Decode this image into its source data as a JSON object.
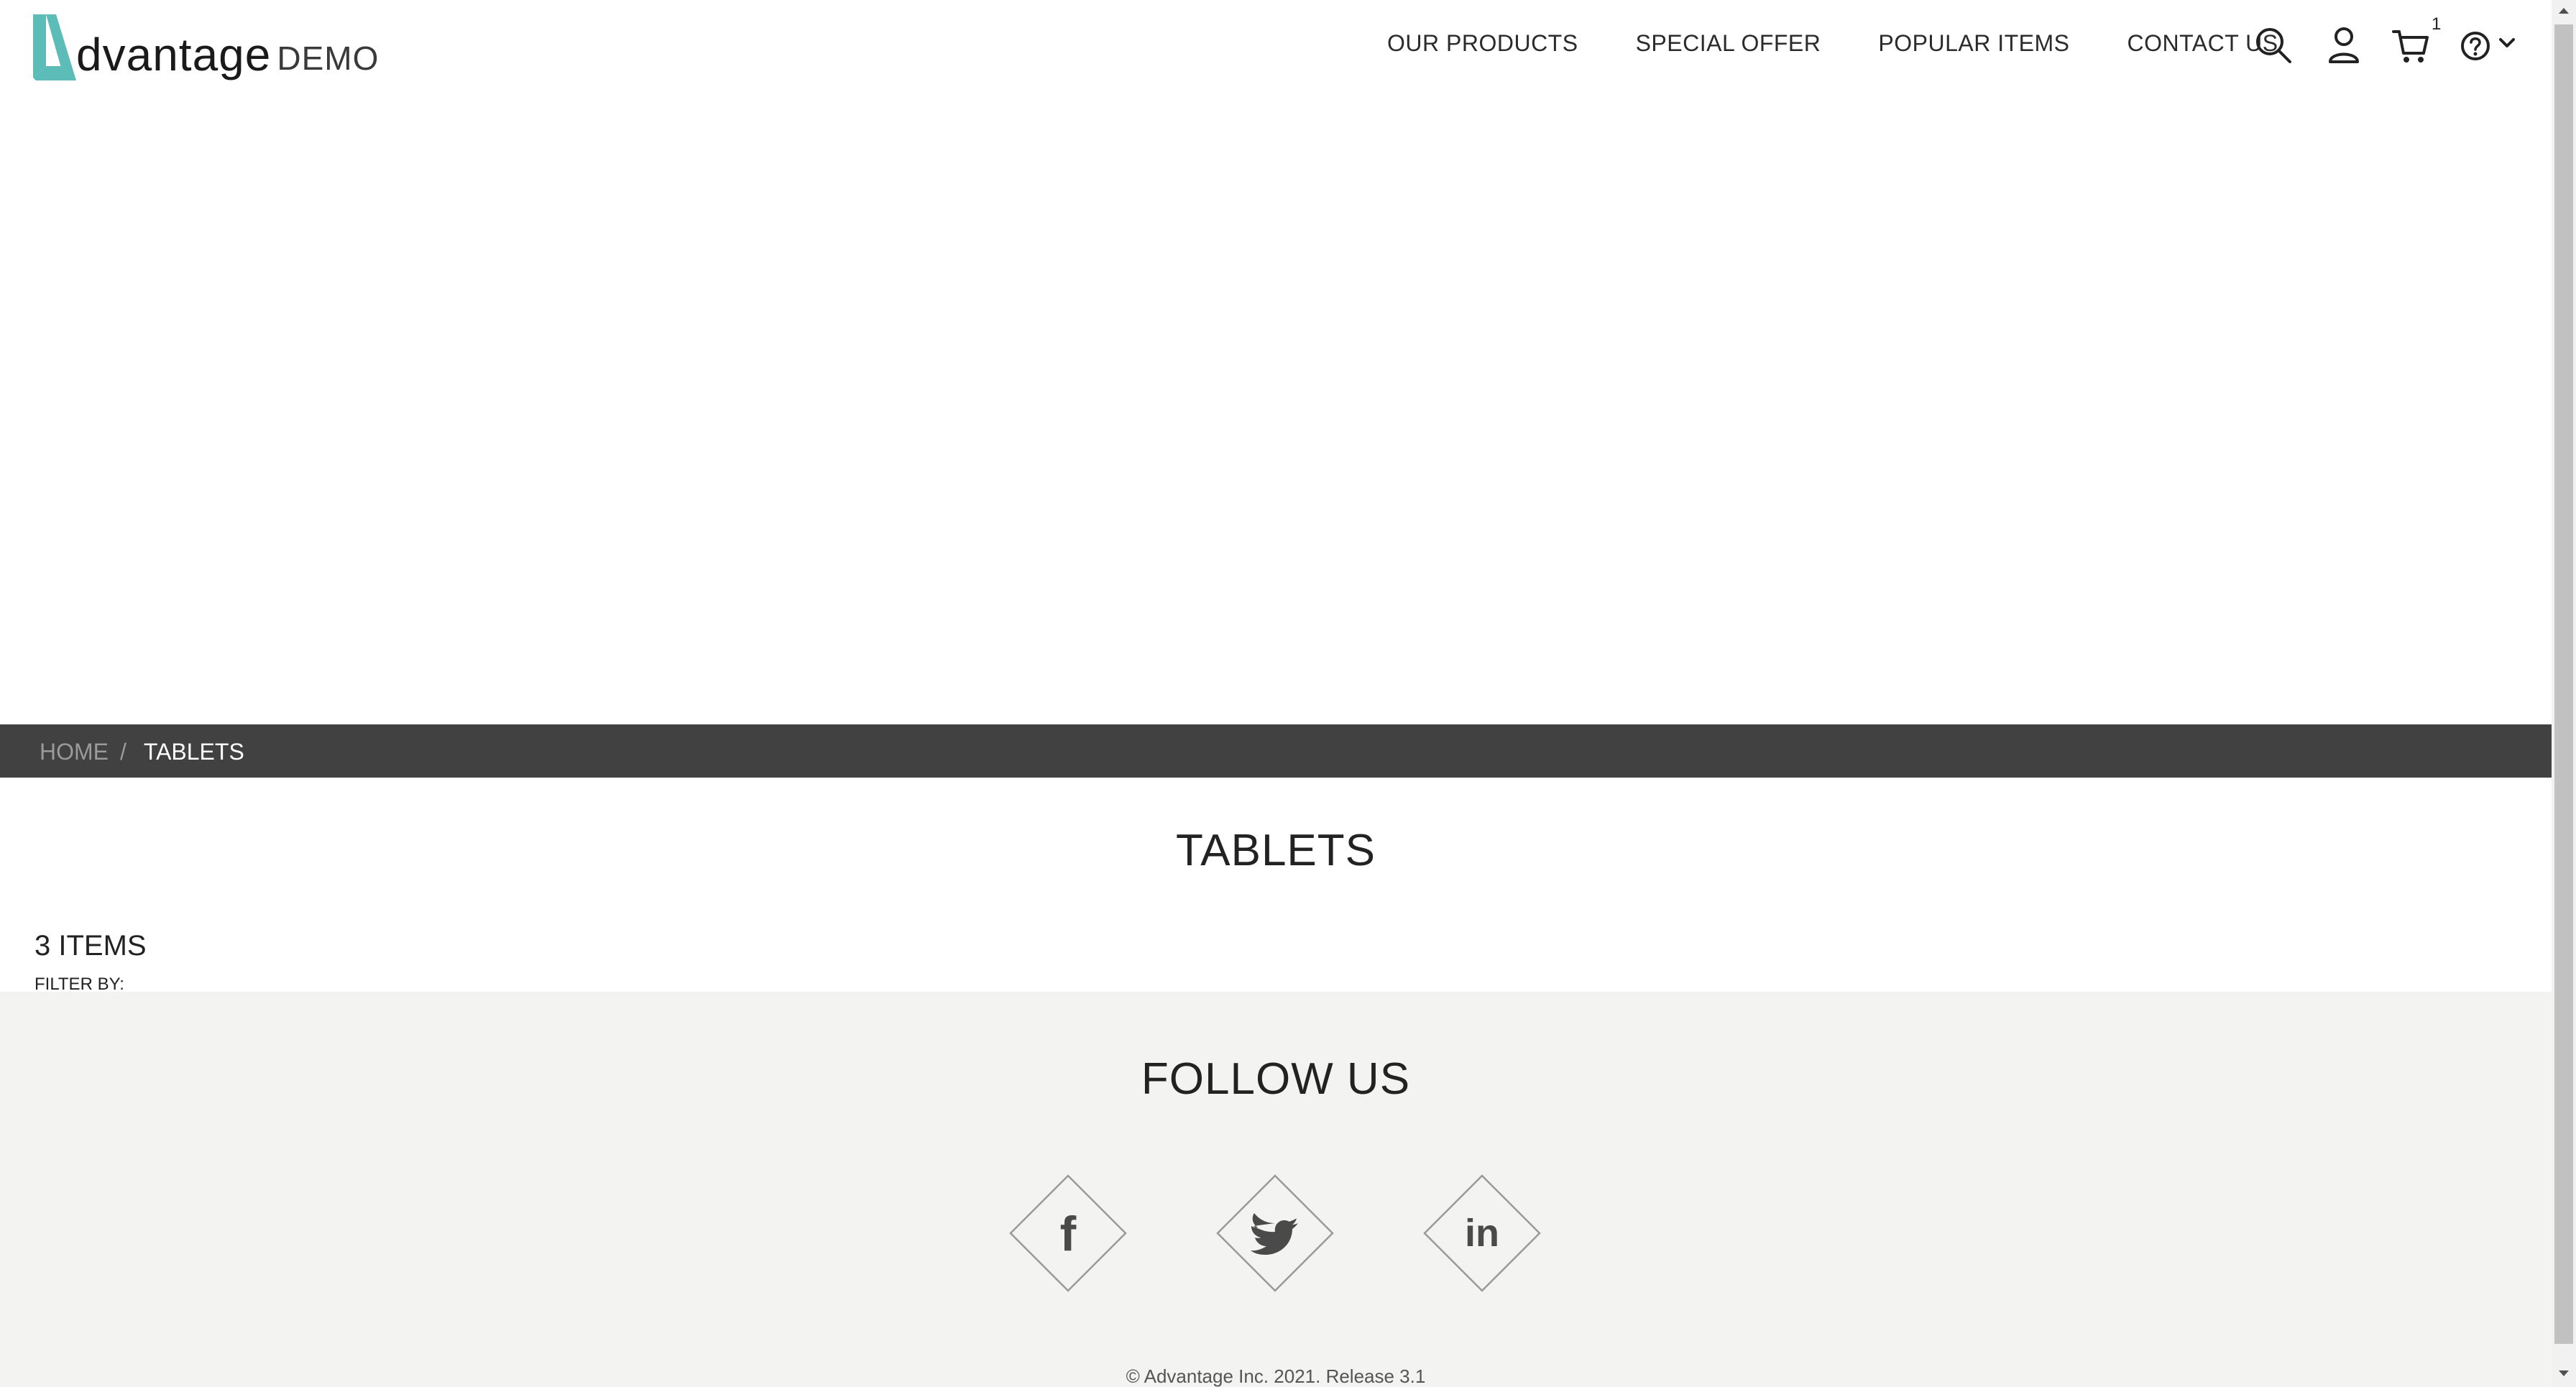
{
  "header": {
    "logo": {
      "brand": "dvantage",
      "suffix": "DEMO",
      "icon": "advantage-logo-icon"
    },
    "nav": [
      {
        "label": "OUR PRODUCTS"
      },
      {
        "label": "SPECIAL OFFER"
      },
      {
        "label": "POPULAR ITEMS"
      },
      {
        "label": "CONTACT US"
      }
    ],
    "icons": {
      "search": "search-icon",
      "user": "user-icon",
      "cart": "cart-icon",
      "help": "help-icon",
      "help_menu": "chevron-down-icon"
    },
    "cart_count": "1"
  },
  "breadcrumb": {
    "home": "HOME",
    "separator": "/",
    "current": "TABLETS"
  },
  "category": {
    "title": "TABLETS",
    "items_count": "3 ITEMS",
    "filter_label": "FILTER BY:"
  },
  "footer": {
    "follow_title": "FOLLOW US",
    "social": [
      {
        "name": "facebook-icon"
      },
      {
        "name": "twitter-icon"
      },
      {
        "name": "linkedin-icon"
      }
    ],
    "copyright": "© Advantage Inc. 2021. Release 3.1"
  },
  "colors": {
    "brand_teal": "#5bbcb8",
    "breadcrumb_bg": "#414141",
    "footer_bg": "#f3f3f2"
  }
}
